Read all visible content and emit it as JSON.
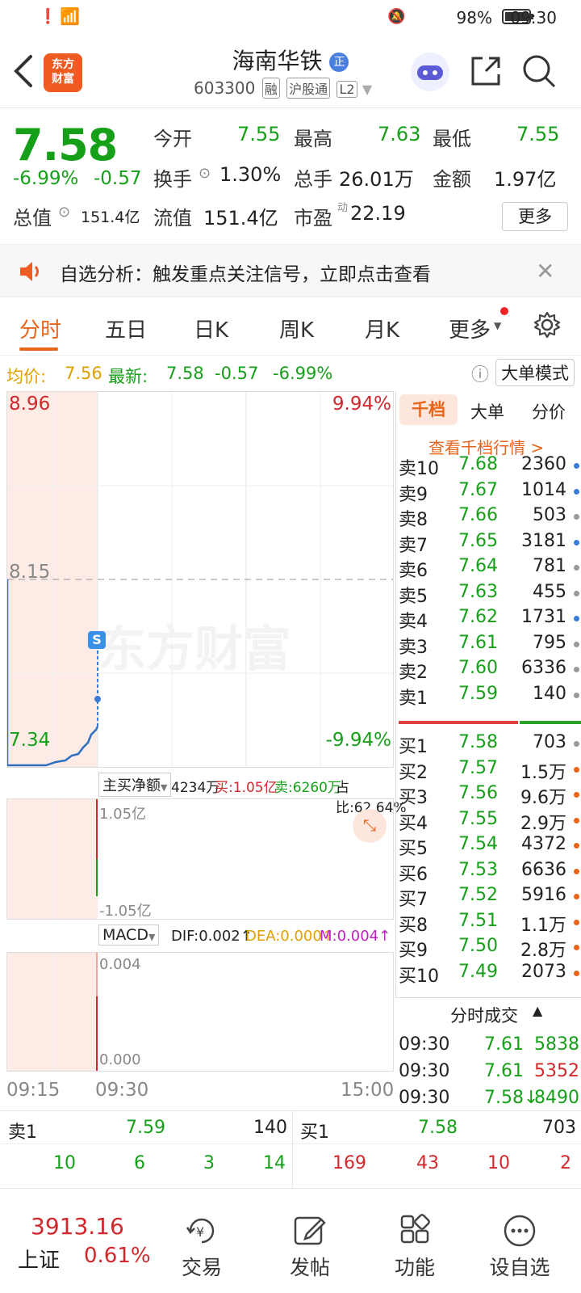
{
  "status": {
    "battery": "98%",
    "time": "09:30"
  },
  "header": {
    "logo_line1": "东方",
    "logo_line2": "财富",
    "stock_name": "海南华铁",
    "name_badge": "正",
    "code": "603300",
    "tags": [
      "融",
      "沪股通",
      "L2"
    ]
  },
  "quote": {
    "price": "7.58",
    "change_pct": "-6.99%",
    "change": "-0.57",
    "open_label": "今开",
    "open": "7.55",
    "high_label": "最高",
    "high": "7.63",
    "low_label": "最低",
    "low": "7.55",
    "turnover_label": "换手",
    "turnover": "1.30%",
    "volume_label": "总手",
    "volume": "26.01万",
    "amount_label": "金额",
    "amount": "1.97亿",
    "mktcap_label": "总值",
    "mktcap": "151.4亿",
    "float_label": "流值",
    "float": "151.4亿",
    "pe_label": "市盈",
    "pe_sup": "动",
    "pe": "22.19",
    "more_label": "更多"
  },
  "notice": {
    "text": "自选分析：触发重点关注信号，立即点击查看"
  },
  "tabs": [
    "分时",
    "五日",
    "日K",
    "周K",
    "月K",
    "更多"
  ],
  "info": {
    "avg_label": "均价:",
    "avg": "7.56",
    "last_label": "最新:",
    "last": "7.58",
    "change": "-0.57",
    "change_pct": "-6.99%",
    "mode_label": "大单模式"
  },
  "chart": {
    "y_top": "8.96",
    "y_mid": "8.15",
    "y_bottom": "7.34",
    "pct_top": "9.94%",
    "pct_bottom": "-9.94%",
    "watermark": "东方财富",
    "marker": "S",
    "netflow_label": "主买净额",
    "netflow": "4234万",
    "buy_label": "买:1.05亿",
    "sell_label": "卖:6260万",
    "ratio_label": "占比:62.64%",
    "flow_top": "1.05亿",
    "flow_bottom": "-1.05亿",
    "macd_label": "MACD",
    "dif": "DIF:0.002↑",
    "dea": "DEA:0.000↑",
    "m": "M:0.004↑",
    "macd_top": "0.004",
    "macd_bottom": "0.000",
    "t_start": "09:15",
    "t_open": "09:30",
    "t_end": "15:00"
  },
  "side": {
    "tabs": [
      "千档",
      "大单",
      "分价"
    ],
    "link": "查看千档行情 >",
    "asks": [
      {
        "label": "卖10",
        "price": "7.68",
        "vol": "2360",
        "dot": "#3a7bd5"
      },
      {
        "label": "卖9",
        "price": "7.67",
        "vol": "1014",
        "dot": "#3a7bd5"
      },
      {
        "label": "卖8",
        "price": "7.66",
        "vol": "503",
        "dot": "#999999"
      },
      {
        "label": "卖7",
        "price": "7.65",
        "vol": "3181",
        "dot": "#3a7bd5"
      },
      {
        "label": "卖6",
        "price": "7.64",
        "vol": "781",
        "dot": "#999999"
      },
      {
        "label": "卖5",
        "price": "7.63",
        "vol": "455",
        "dot": "#999999"
      },
      {
        "label": "卖4",
        "price": "7.62",
        "vol": "1731",
        "dot": "#3a7bd5"
      },
      {
        "label": "卖3",
        "price": "7.61",
        "vol": "795",
        "dot": "#999999"
      },
      {
        "label": "卖2",
        "price": "7.60",
        "vol": "6336",
        "dot": "#999999"
      },
      {
        "label": "卖1",
        "price": "7.59",
        "vol": "140",
        "dot": "#999999"
      }
    ],
    "bids": [
      {
        "label": "买1",
        "price": "7.58",
        "vol": "703",
        "dot": "#999999"
      },
      {
        "label": "买2",
        "price": "7.57",
        "vol": "1.5万",
        "dot": "#e8641b"
      },
      {
        "label": "买3",
        "price": "7.56",
        "vol": "9.6万",
        "dot": "#e8641b"
      },
      {
        "label": "买4",
        "price": "7.55",
        "vol": "2.9万",
        "dot": "#e8641b"
      },
      {
        "label": "买5",
        "price": "7.54",
        "vol": "4372",
        "dot": "#e8641b"
      },
      {
        "label": "买6",
        "price": "7.53",
        "vol": "6636",
        "dot": "#e8641b"
      },
      {
        "label": "买7",
        "price": "7.52",
        "vol": "5916",
        "dot": "#e8641b"
      },
      {
        "label": "买8",
        "price": "7.51",
        "vol": "1.1万",
        "dot": "#e8641b"
      },
      {
        "label": "买9",
        "price": "7.50",
        "vol": "2.8万",
        "dot": "#e8641b"
      },
      {
        "label": "买10",
        "price": "7.49",
        "vol": "2073",
        "dot": "#e8641b"
      }
    ],
    "trades_label": "分时成交",
    "trades": [
      {
        "time": "09:30",
        "price": "7.61",
        "vol": "5838",
        "color": "#16a01a"
      },
      {
        "time": "09:30",
        "price": "7.61",
        "vol": "5352",
        "color": "#d0282c"
      },
      {
        "time": "09:30",
        "price": "7.58↓",
        "vol": "8490",
        "color": "#16a01a"
      }
    ]
  },
  "bottom_book": {
    "sell_label": "卖1",
    "sell_price": "7.59",
    "sell_vol": "140",
    "buy_label": "买1",
    "buy_price": "7.58",
    "buy_vol": "703",
    "sell_nums": [
      "10",
      "6",
      "3",
      "14"
    ],
    "buy_nums": [
      "169",
      "43",
      "10",
      "2"
    ]
  },
  "bottom_nav": {
    "index_value": "3913.16",
    "index_name": "上证",
    "index_pct": "0.61%",
    "items": [
      "交易",
      "发帖",
      "功能",
      "设自选"
    ]
  }
}
